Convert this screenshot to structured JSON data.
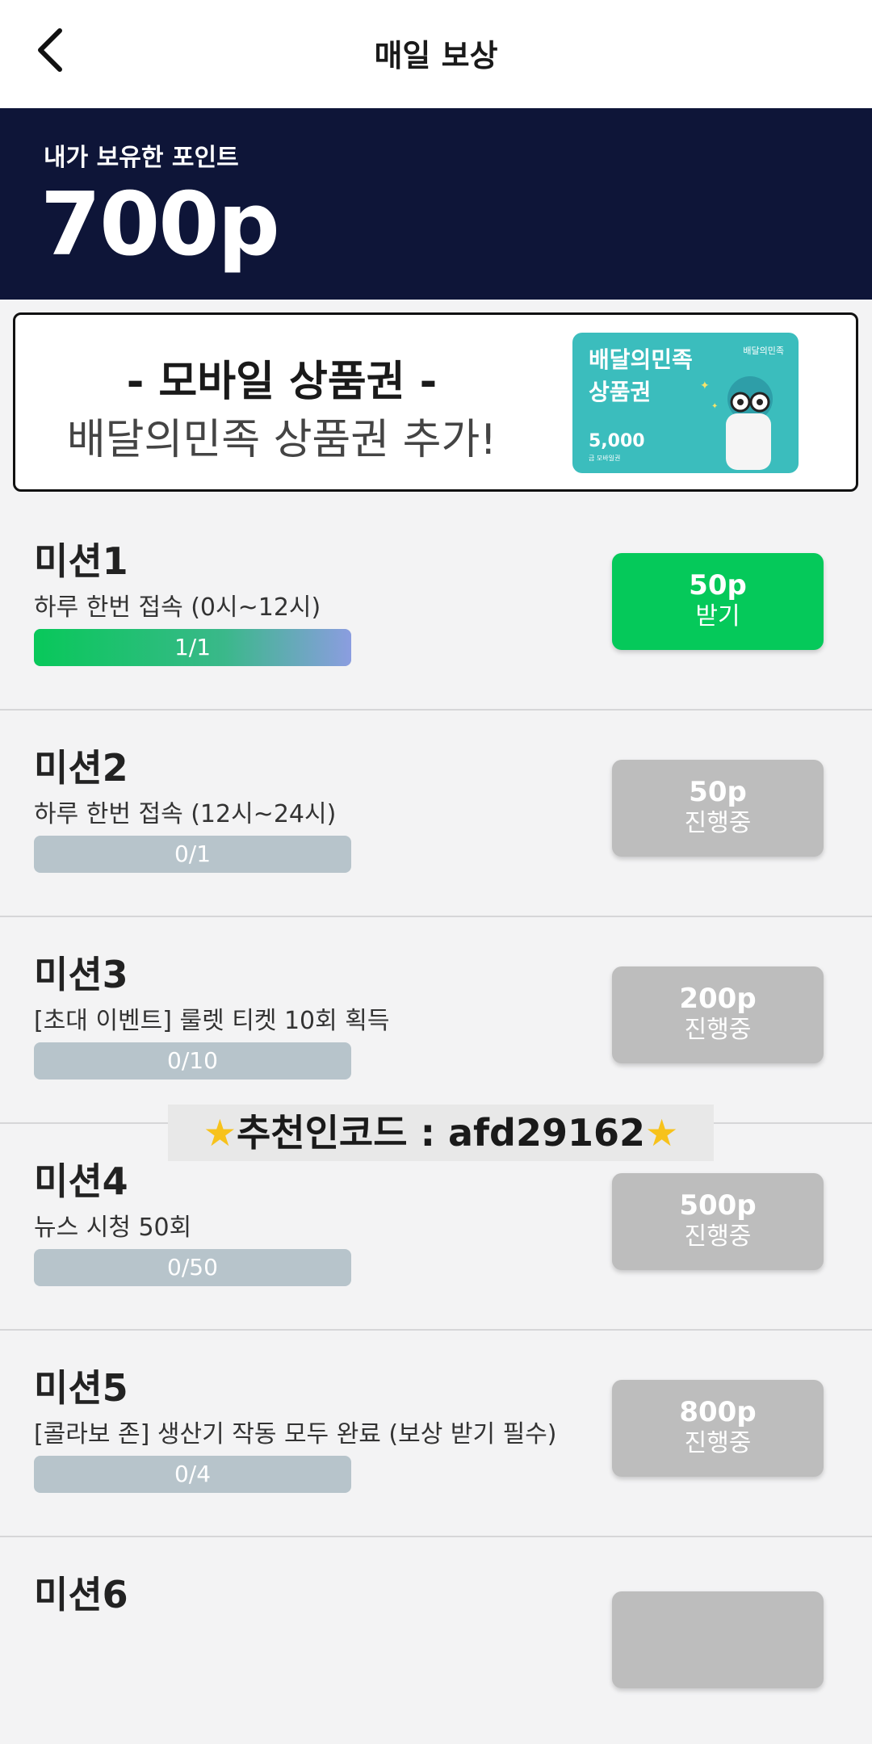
{
  "header": {
    "title": "매일 보상"
  },
  "points": {
    "label": "내가 보유한 포인트",
    "value": "700p"
  },
  "promo": {
    "title": "- 모바일 상품권 -",
    "subtitle": "배달의민족 상품권 추가!",
    "giftcard": {
      "name": "배달의민족 상품권",
      "brand": "배달의민족",
      "amount": "5,000",
      "note": "금 모바일권"
    }
  },
  "missions": [
    {
      "title": "미션1",
      "desc": "하루 한번 접속 (0시~12시)",
      "progress": "1/1",
      "progress_fraction": 1.0,
      "points": "50p",
      "status": "받기",
      "state": "active"
    },
    {
      "title": "미션2",
      "desc": "하루 한번 접속 (12시~24시)",
      "progress": "0/1",
      "progress_fraction": 0,
      "points": "50p",
      "status": "진행중",
      "state": "pending"
    },
    {
      "title": "미션3",
      "desc": "[초대 이벤트] 룰렛 티켓 10회 획득",
      "progress": "0/10",
      "progress_fraction": 0,
      "points": "200p",
      "status": "진행중",
      "state": "pending"
    },
    {
      "title": "미션4",
      "desc": "뉴스 시청 50회",
      "progress": "0/50",
      "progress_fraction": 0,
      "points": "500p",
      "status": "진행중",
      "state": "pending"
    },
    {
      "title": "미션5",
      "desc": "[콜라보 존] 생산기 작동 모두 완료 (보상 받기 필수)",
      "progress": "0/4",
      "progress_fraction": 0,
      "points": "800p",
      "status": "진행중",
      "state": "pending"
    },
    {
      "title": "미션6"
    }
  ],
  "referral": {
    "text": "추천인코드 : afd29162"
  },
  "colors": {
    "header_bg": "#0e1538",
    "active_button": "#05c95a",
    "pending_button": "#bdbdbd",
    "progress_empty": "#b7c4cb"
  }
}
